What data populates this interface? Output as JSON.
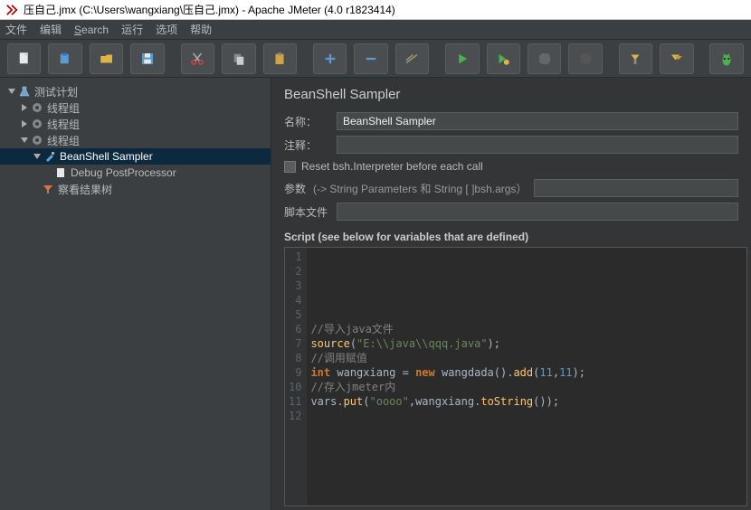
{
  "window": {
    "title": "压自己.jmx (C:\\Users\\wangxiang\\压自己.jmx) - Apache JMeter (4.0 r1823414)"
  },
  "menubar": {
    "items": [
      "文件",
      "编辑",
      "Search",
      "运行",
      "选项",
      "帮助"
    ]
  },
  "toolbar": {
    "buttons": [
      {
        "name": "new-icon"
      },
      {
        "name": "trash-icon"
      },
      {
        "name": "open-icon"
      },
      {
        "name": "save-icon"
      },
      {
        "name": "cut-icon"
      },
      {
        "name": "copy-icon"
      },
      {
        "name": "paste-icon"
      },
      {
        "name": "plus-icon"
      },
      {
        "name": "minus-icon"
      },
      {
        "name": "wand-icon"
      },
      {
        "name": "run-icon"
      },
      {
        "name": "run-now-icon"
      },
      {
        "name": "stop-icon"
      },
      {
        "name": "shutdown-icon"
      },
      {
        "name": "settings-icon"
      },
      {
        "name": "clear-icon"
      },
      {
        "name": "beetle-icon"
      }
    ]
  },
  "tree": {
    "root": {
      "label": "测试计划",
      "expanded": true
    },
    "group1": {
      "label": "线程组"
    },
    "group2": {
      "label": "线程组"
    },
    "group3": {
      "label": "线程组",
      "expanded": true
    },
    "sampler": {
      "label": "BeanShell Sampler"
    },
    "postproc": {
      "label": "Debug PostProcessor"
    },
    "resulttree": {
      "label": "察看结果树"
    }
  },
  "panel": {
    "title": "BeanShell Sampler",
    "name_label": "名称：",
    "name_value": "BeanShell Sampler",
    "comment_label": "注释：",
    "comment_value": "",
    "reset_label": "Reset bsh.Interpreter before each call",
    "params_label": "参数",
    "params_hint": "(-> String Parameters 和 String [ ]bsh.args）",
    "params_value": "",
    "scriptfile_label": "脚本文件",
    "scriptfile_value": "",
    "script_header": "Script (see below for variables that are defined)"
  },
  "code": {
    "lines": [
      {
        "n": 1,
        "segs": []
      },
      {
        "n": 2,
        "segs": []
      },
      {
        "n": 3,
        "segs": []
      },
      {
        "n": 4,
        "segs": []
      },
      {
        "n": 5,
        "segs": []
      },
      {
        "n": 6,
        "segs": [
          {
            "t": "//导入java文件",
            "c": "tok-comment"
          }
        ]
      },
      {
        "n": 7,
        "segs": [
          {
            "t": "source",
            "c": "tok-fn"
          },
          {
            "t": "(",
            "c": ""
          },
          {
            "t": "\"E:\\\\java\\\\qqq.java\"",
            "c": "tok-str"
          },
          {
            "t": ");",
            "c": ""
          }
        ]
      },
      {
        "n": 8,
        "segs": [
          {
            "t": "//调用赋值",
            "c": "tok-comment"
          }
        ]
      },
      {
        "n": 9,
        "segs": [
          {
            "t": "int",
            "c": "tok-kw"
          },
          {
            "t": " wangxiang = ",
            "c": ""
          },
          {
            "t": "new",
            "c": "tok-kw"
          },
          {
            "t": " wangdada().",
            "c": ""
          },
          {
            "t": "add",
            "c": "tok-fn"
          },
          {
            "t": "(",
            "c": ""
          },
          {
            "t": "11",
            "c": "tok-num"
          },
          {
            "t": ",",
            "c": ""
          },
          {
            "t": "11",
            "c": "tok-num"
          },
          {
            "t": ");",
            "c": ""
          }
        ]
      },
      {
        "n": 10,
        "segs": [
          {
            "t": "//存入jmeter内",
            "c": "tok-comment"
          }
        ]
      },
      {
        "n": 11,
        "segs": [
          {
            "t": "vars.",
            "c": ""
          },
          {
            "t": "put",
            "c": "tok-fn"
          },
          {
            "t": "(",
            "c": ""
          },
          {
            "t": "\"oooo\"",
            "c": "tok-str"
          },
          {
            "t": ",wangxiang.",
            "c": ""
          },
          {
            "t": "toString",
            "c": "tok-fn"
          },
          {
            "t": "());",
            "c": ""
          }
        ]
      },
      {
        "n": 12,
        "segs": []
      }
    ]
  }
}
